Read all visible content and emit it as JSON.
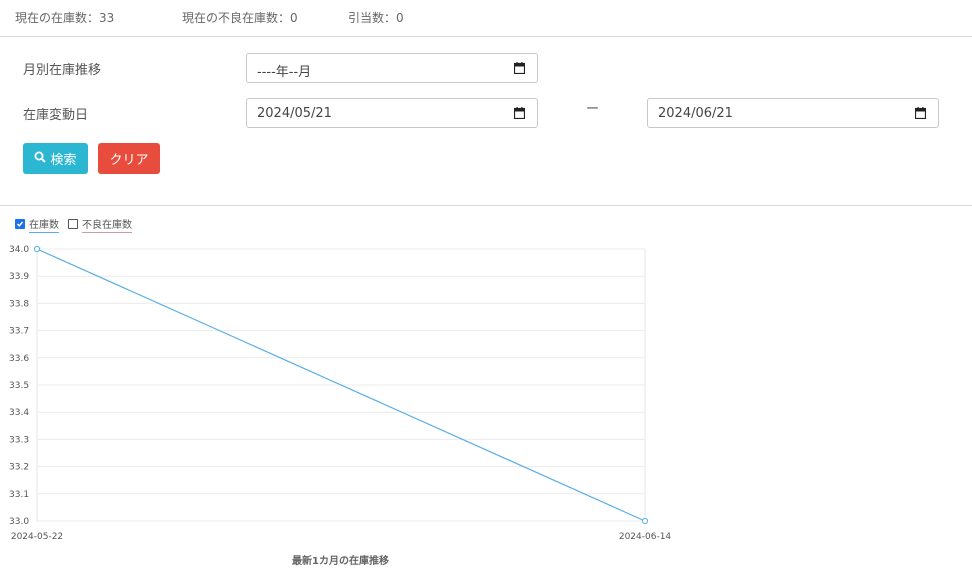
{
  "stats": {
    "current_stock": "現在の在庫数：33",
    "current_defective": "現在の不良在庫数：0",
    "allocated": "引当数：0"
  },
  "form": {
    "monthly_label": "月別在庫推移",
    "monthly_value": "----年--月",
    "change_date_label": "在庫変動日",
    "date_from": "2024/05/21",
    "range_separator": "ー",
    "date_to": "2024/06/21"
  },
  "buttons": {
    "search_label": "検索",
    "clear_label": "クリア"
  },
  "icons": {
    "search": "search-icon",
    "calendar": "calendar-icon"
  },
  "colors": {
    "search_button": "#2bb6d2",
    "clear_button": "#e84c3d",
    "series_stock": "#5aaee6",
    "series_defective": "#c99ab0"
  },
  "legend": {
    "stock": "在庫数",
    "defective": "不良在庫数"
  },
  "chart_data": {
    "type": "line",
    "title": "最新1カ月の在庫推移",
    "x": [
      "2024-05-22",
      "2024-06-14"
    ],
    "series": [
      {
        "name": "在庫数",
        "values": [
          34.0,
          33.0
        ],
        "visible": true
      },
      {
        "name": "不良在庫数",
        "values": [],
        "visible": false
      }
    ],
    "ylim": [
      33.0,
      34.0
    ],
    "yticks": [
      "34.0",
      "33.9",
      "33.8",
      "33.7",
      "33.6",
      "33.5",
      "33.4",
      "33.3",
      "33.2",
      "33.1",
      "33.0"
    ],
    "grid": true,
    "legend_position": "top-left"
  }
}
